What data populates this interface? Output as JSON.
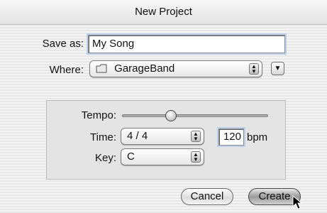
{
  "window": {
    "title": "New Project"
  },
  "save_as": {
    "label": "Save as:",
    "value": "My Song"
  },
  "where": {
    "label": "Where:",
    "selected": "GarageBand",
    "folder_icon": "folder-icon",
    "disclosure_icon": "chevron-down-icon"
  },
  "tempo": {
    "label": "Tempo:",
    "slider_fraction": 0.35
  },
  "time": {
    "label": "Time:",
    "selected": "4 / 4",
    "bpm_value": "120",
    "bpm_unit": "bpm"
  },
  "key": {
    "label": "Key:",
    "selected": "C"
  },
  "buttons": {
    "cancel_label": "Cancel",
    "create_label": "Create"
  }
}
